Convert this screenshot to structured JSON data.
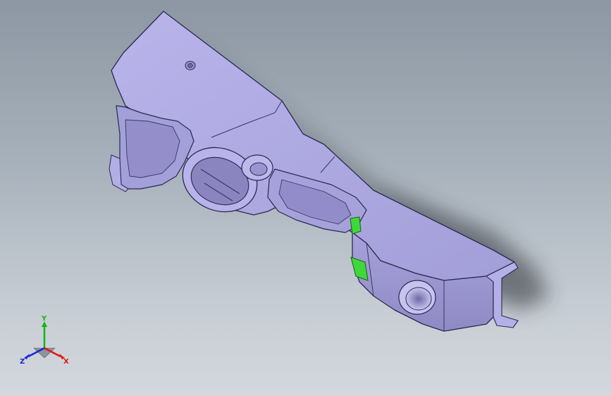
{
  "view": {
    "background_top": "#8c97a3",
    "background_bottom": "#d3d8dd",
    "part_color": "#aba6de",
    "highlight_color": "#3ed83a"
  },
  "triad": {
    "x_label": "X",
    "y_label": "Y",
    "z_label": "Z",
    "x_color": "#e01515",
    "y_color": "#13b513",
    "z_color": "#1a27d6"
  }
}
